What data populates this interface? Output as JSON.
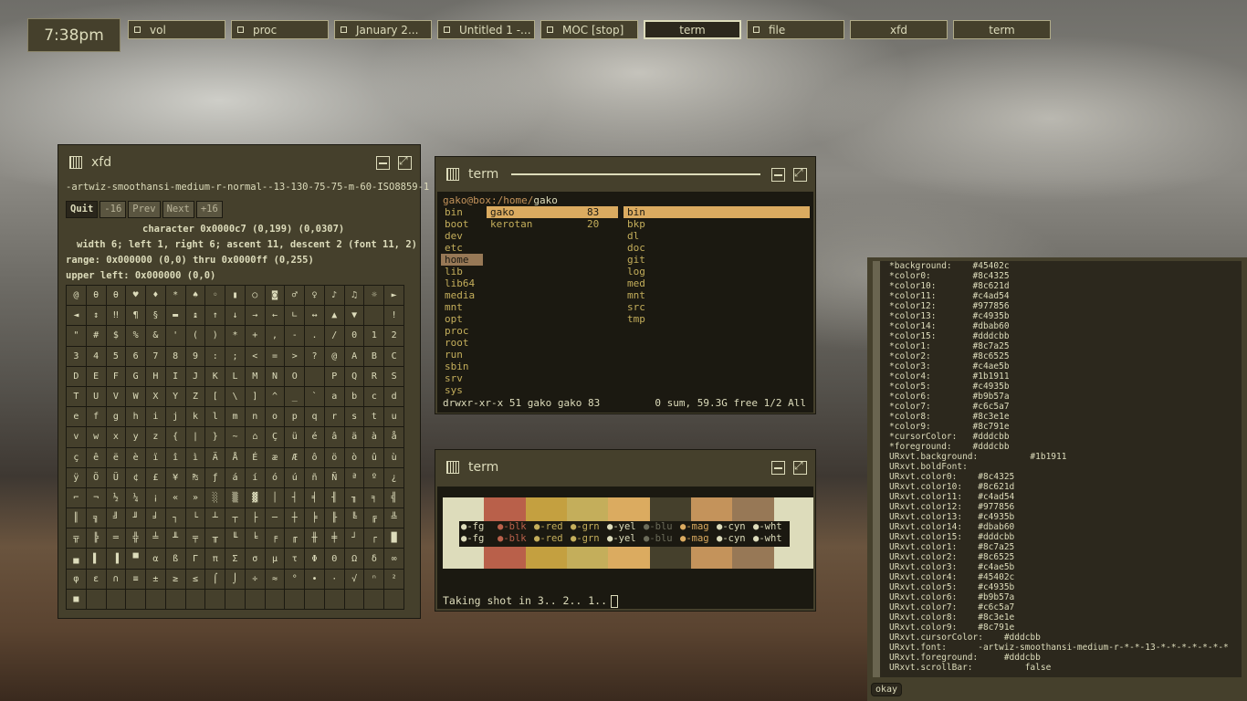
{
  "clock": "7:38pm",
  "taskbar": [
    {
      "label": "vol",
      "active": false
    },
    {
      "label": "proc",
      "active": false
    },
    {
      "label": "January 2...",
      "active": false
    },
    {
      "label": "Untitled 1 -...",
      "active": false
    },
    {
      "label": "MOC [stop]",
      "active": false
    },
    {
      "label": "term",
      "active": true
    },
    {
      "label": "file",
      "active": false
    },
    {
      "label": "xfd",
      "active": false,
      "nosq": true
    },
    {
      "label": "term",
      "active": false,
      "nosq": true
    }
  ],
  "xfd": {
    "title": "xfd",
    "font": "-artwiz-smoothansi-medium-r-normal--13-130-75-75-m-60-ISO8859-1",
    "buttons": [
      "Quit",
      "-16",
      "Prev",
      "Next",
      "+16"
    ],
    "info1": "character 0x0000c7 (0,199) (0,0307)",
    "info2": "width 6; left 1, right 6; ascent 11, descent 2 (font 11, 2)",
    "info3": "range:  0x000000 (0,0) thru 0x0000ff (0,255)",
    "info4": "upper left:  0x000000 (0,0)",
    "glyphs": "@θθ♥♦*♠◦▮○◙♂♀♪♫☼►◄↕‼¶§▬↨↑↓→←∟↔▲▼ !\"#$%&'()*+,-./0123456789:;<=>?@ABCDEFGHIJKLMNO PQRSTUVWXYZ[\\]^_`abcdefghijklmnopqrstuvwxyz{|}~⌂ÇüéâäàåçêëèïîìÄÅÉæÆôöòûùÿÖÜ¢£¥₧ƒáíóúñÑªº¿⌐¬½¼¡«»░▒▓│┤╡╢╖╕╣║╗╝╜╛┐└┴┬├─┼╞╟╚╔╩╦╠═╬╧╨╤╥╙╘╒╓╫╪┘┌█▄▌▐▀αßΓπΣσµτΦΘΩδ∞φε∩≡±≥≤⌠⌡÷≈°∙·√ⁿ²■ "
  },
  "term1": {
    "title": "term",
    "prompt_user": "gako@box",
    "prompt_path": ":/home/",
    "prompt_cur": "gako",
    "col1": [
      "bin",
      "boot",
      "dev",
      "etc",
      "home",
      "lib",
      "lib64",
      "media",
      "mnt",
      "opt",
      "proc",
      "root",
      "run",
      "sbin",
      "srv",
      "sys"
    ],
    "col1_sel": 4,
    "col2": [
      {
        "name": "gako",
        "size": "83"
      },
      {
        "name": "kerotan",
        "size": "20"
      }
    ],
    "col3": [
      "bin",
      "bkp",
      "dl",
      "doc",
      "git",
      "log",
      "med",
      "mnt",
      "src",
      "tmp"
    ],
    "status_left": "drwxr-xr-x 51 gako gako 83",
    "status_right": "0 sum, 59.3G free  1/2  All"
  },
  "term2": {
    "title": "term",
    "labels": [
      "fg",
      "blk",
      "red",
      "grn",
      "yel",
      "blu",
      "mag",
      "cyn",
      "wht"
    ],
    "label_colors": [
      "#dddcbb",
      "#b9604a",
      "#c4ae5b",
      "#c4ae5b",
      "#dddcbb",
      "#6c6c5a",
      "#dbab60",
      "#dddcbb",
      "#dddcbb"
    ],
    "palette": [
      "#dddcbb",
      "#b9604a",
      "#c4a040",
      "#c4ae5b",
      "#dbab60",
      "#45402c",
      "#c4935b",
      "#977856",
      "#dddcbb"
    ],
    "shot": "Taking shot in 3.. 2.. 1.."
  },
  "xres": [
    "*background:    #45402c",
    "*color0:        #8c4325",
    "*color10:       #8c621d",
    "*color11:       #c4ad54",
    "*color12:       #977856",
    "*color13:       #c4935b",
    "*color14:       #dbab60",
    "*color15:       #dddcbb",
    "*color1:        #8c7a25",
    "*color2:        #8c6525",
    "*color3:        #c4ae5b",
    "*color4:        #1b1911",
    "*color5:        #c4935b",
    "*color6:        #b9b57a",
    "*color7:        #c6c5a7",
    "*color8:        #8c3e1e",
    "*color9:        #8c791e",
    "*cursorColor:   #dddcbb",
    "*foreground:    #dddcbb",
    "URxvt.background:          #1b1911",
    "URxvt.boldFont:",
    "URxvt.color0:    #8c4325",
    "URxvt.color10:   #8c621d",
    "URxvt.color11:   #c4ad54",
    "URxvt.color12:   #977856",
    "URxvt.color13:   #c4935b",
    "URxvt.color14:   #dbab60",
    "URxvt.color15:   #dddcbb",
    "URxvt.color1:    #8c7a25",
    "URxvt.color2:    #8c6525",
    "URxvt.color3:    #c4ae5b",
    "URxvt.color4:    #45402c",
    "URxvt.color5:    #c4935b",
    "URxvt.color6:    #b9b57a",
    "URxvt.color7:    #c6c5a7",
    "URxvt.color8:    #8c3e1e",
    "URxvt.color9:    #8c791e",
    "URxvt.cursorColor:    #dddcbb",
    "URxvt.font:      -artwiz-smoothansi-medium-r-*-*-13-*-*-*-*-*-*-*",
    "URxvt.foreground:     #dddcbb",
    "URxvt.scrollBar:          false"
  ],
  "okay": "okay"
}
